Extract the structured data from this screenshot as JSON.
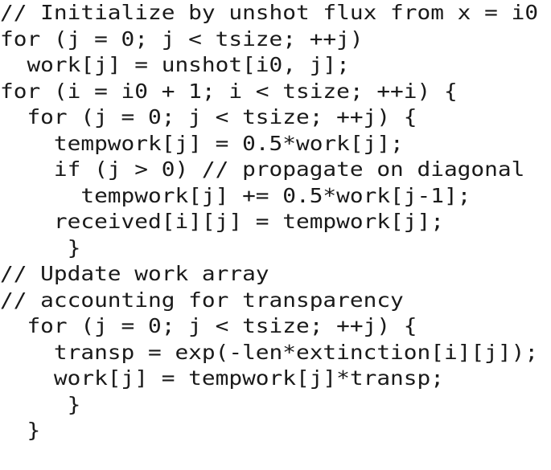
{
  "listing": {
    "language": "c",
    "text_color": "#1a1a1a",
    "background_color": "#ffffff",
    "line_count": 18,
    "lines": [
      "// Initialize by unshot flux from x = i0",
      "for (j = 0; j < tsize; ++j)",
      "  work[j] = unshot[i0, j];",
      "for (i = i0 + 1; i < tsize; ++i) {",
      "  for (j = 0; j < tsize; ++j) {",
      "    tempwork[j] = 0.5*work[j];",
      "    if (j > 0) // propagate on diagonal",
      "      tempwork[j] += 0.5*work[j-1];",
      "    received[i][j] = tempwork[j];",
      "     }",
      "// Update work array",
      "// accounting for transparency",
      "  for (j = 0; j < tsize; ++j) {",
      "    transp = exp(-len*extinction[i][j]);",
      "    work[j] = tempwork[j]*transp;",
      "     }",
      "  }"
    ]
  }
}
